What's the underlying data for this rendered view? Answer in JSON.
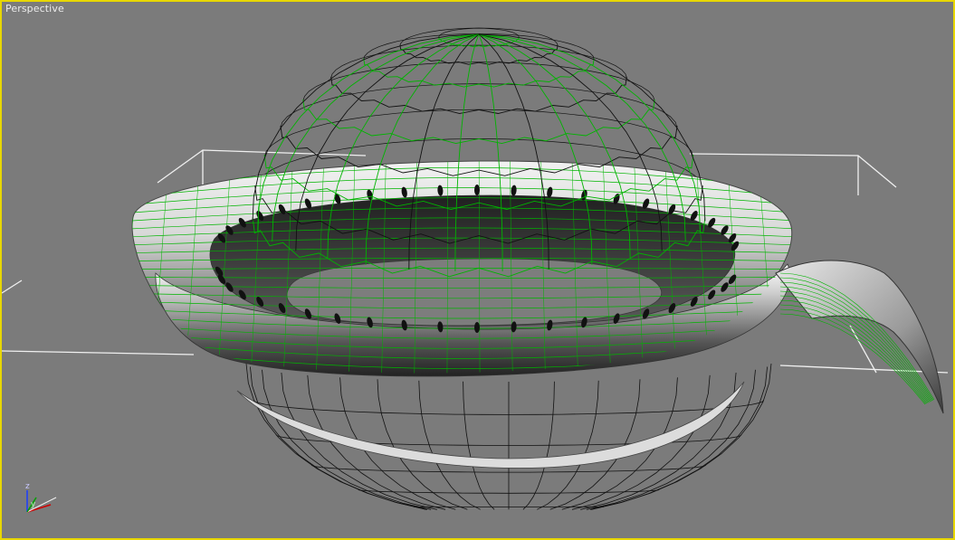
{
  "viewport": {
    "label": "Perspective",
    "border_color": "#e8d700",
    "background_color": "#7b7b7b"
  },
  "colors": {
    "wireframe_green": "#00b400",
    "wireframe_black": "#111111",
    "grid_white": "#f0f0f0",
    "axis_x": "#d00000",
    "axis_y": "#00a000",
    "axis_z": "#1a3cff"
  },
  "gizmo": {
    "z_label": "z",
    "y_label": "y"
  },
  "objects": [
    {
      "name": "dome-wireframe",
      "kind": "wireframe-sphere"
    },
    {
      "name": "bowl-ring",
      "kind": "shaded-torus"
    },
    {
      "name": "bowl-handle",
      "kind": "shaded-spout"
    },
    {
      "name": "bowl-base-wireframe",
      "kind": "wireframe-hemisphere"
    }
  ]
}
